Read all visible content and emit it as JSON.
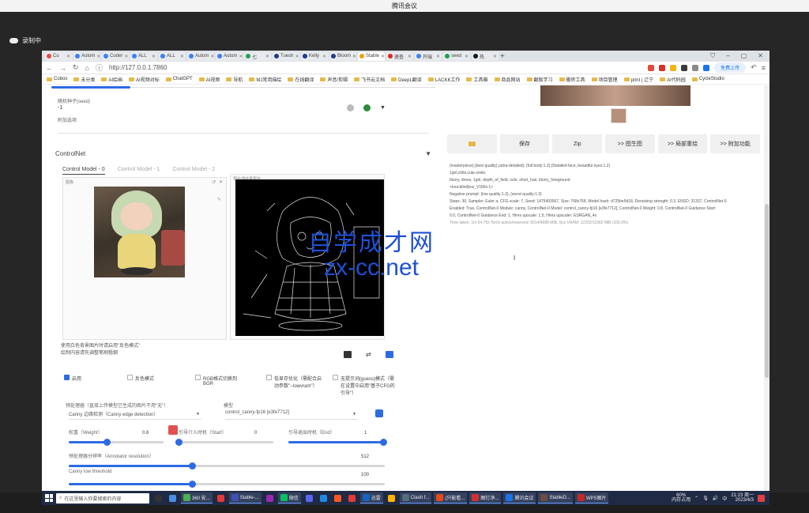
{
  "meeting": {
    "title": "腾讯会议",
    "recording": "录制中"
  },
  "browser": {
    "tabs": [
      {
        "label": "Cu",
        "color": "#e54b3c",
        "active": false
      },
      {
        "label": "Autom",
        "color": "#3b82f6",
        "active": false
      },
      {
        "label": "Coder",
        "color": "#3b82f6",
        "active": false
      },
      {
        "label": "ALL",
        "color": "#3b82f6",
        "active": false
      },
      {
        "label": "ALL",
        "color": "#3b82f6",
        "active": false
      },
      {
        "label": "Autom",
        "color": "#3b82f6",
        "active": false
      },
      {
        "label": "Autom",
        "color": "#3b82f6",
        "active": false
      },
      {
        "label": "七",
        "color": "#22a34a",
        "active": false
      },
      {
        "label": "Tuesh",
        "color": "#1e3a8a",
        "active": false
      },
      {
        "label": "Kelly",
        "color": "#1e3a8a",
        "active": false
      },
      {
        "label": "Bloom",
        "color": "#1e3a8a",
        "active": false
      },
      {
        "label": "Stable",
        "color": "#f59e0b",
        "active": true
      },
      {
        "label": "速查",
        "color": "#dc2626",
        "active": false
      },
      {
        "label": "开端",
        "color": "#3b82f6",
        "active": false
      },
      {
        "label": "seed",
        "color": "#16a34a",
        "active": false
      },
      {
        "label": "热",
        "color": "#111827",
        "active": false
      }
    ],
    "new_tab": "+",
    "url": "http://127.0.0.1:7860",
    "login_label": "免费上传",
    "bookmarks": [
      "Cubox",
      "未分类",
      "AI绘画",
      "AI视频对标",
      "ChatGPT",
      "AI视频",
      "导航",
      "MJ常用描绘",
      "在线翻译",
      "声音/剪辑",
      "飞书云文档",
      "DeepL翻译",
      "LACKK工作",
      "工具箱",
      "商品网站",
      "翻版学习",
      "搬砖工具",
      "项目管理",
      "print | 辽宁",
      "AI代码园",
      "CycleStudio"
    ]
  },
  "left": {
    "seed_label": "随机种子(seed)",
    "seed_value": "-1",
    "seed_extra": "附加选项",
    "controlnet_title": "ControlNet",
    "controlnet_arrow": "▼",
    "tabs": [
      "Control Model - 0",
      "Control Model - 1",
      "Control Model - 2"
    ],
    "image_tag": "图像",
    "preview_tag": "预处理结果预览",
    "hint_line1": "使用白色背景图片时请启用\"反色模式\"",
    "hint_line2": "绘制内容请先调整笔刷粗细",
    "options": {
      "enable": "启用",
      "invert": "反色模式",
      "rgb_bgr": "RGB格式切换到BGR",
      "lowvram": "低显存优化（需配合启动参数\"--lowvram\"）",
      "guess": "无提示词(guess)模式（需在设置中启用\"基于CFG的引导\"）"
    },
    "preprocessor_label": "预处理器（直接上传模型已生成的图片不用\"无\"）",
    "preprocessor_value": "Canny 边缘检测（Canny edge detection）",
    "model_label": "模型",
    "model_value": "control_canny-fp16 [e3fe7712]",
    "weight_label": "权重（Weight）",
    "weight_value": "0.8",
    "weight_level": 0.4,
    "start_label": "引导介入时机（Start）",
    "start_value": "0",
    "start_level": 0.0,
    "end_label": "引导退出时机（End）",
    "end_value": "1",
    "end_level": 1.0,
    "resolution_label": "预处理器分辨率（Annotator resolution）",
    "resolution_value": "512",
    "resolution_level": 0.39,
    "canny_label": "Canny low threshold",
    "canny_value": "100",
    "canny_level": 0.39
  },
  "right": {
    "toolbar": [
      "📁",
      "保存",
      "Zip",
      ">> 图生图",
      ">> 局部重绘",
      ">> 附加功能"
    ],
    "prompt_line1": "(masterpiece),(best quality),(ultra-detailed), (full body:1.2),(Detailed face, beautiful eyes:1.2)",
    "prompt_line2": "1girl,chibi,cute,smile,",
    "prompt_line3": "blurry, dress, 1girl, depth_of_field, solo, short_hair, blurry_foreground",
    "prompt_line4": "<lora:blindbox_V1Mix:1>",
    "negative": "Negative prompt: (low quality:1.3), (worst quality:1.3)",
    "params1": "Steps: 30, Sampler: Euler a, CFG scale: 7, Seed: 1475493967, Size: 768x768, Model hash: d725be5d18, Denoising strength: 0.3, ENSD: 31337, ControlNet-0",
    "params2": "Enabled: True, ControlNet-0 Module: canny, ControlNet-0 Model: control_canny-fp16 [e3fe7712], ControlNet-0 Weight: 0.8, ControlNet-0 Guidance Start:",
    "params3": "0.0, ControlNet-0 Guidance End: 1, Hires upscale: 1.5, Hires upscaler: ESRGAN_4x",
    "time_taken": "Time taken: 1m 54.75s  Torch active/reserved: 8314/9688 MiB, Sys VRAM: 12202/11682 MiB (105.9%)"
  },
  "watermark": {
    "cn": "自学成才网",
    "en": "zx-cc.net"
  },
  "taskbar": {
    "search": "在这里输入你要搜索的内容",
    "apps": [
      "",
      "",
      "360 安...",
      "",
      "Stable-...",
      "",
      "微信",
      "",
      "",
      "",
      "",
      "迅雷",
      "",
      "Clash f...",
      "(只能看...",
      "图钉净...",
      "腾讯会议",
      "StableD...",
      "WPS图片"
    ],
    "memory_line1": "60%",
    "memory_line2": "内存占用",
    "lang": "中",
    "time": "21:23 周一",
    "date": "2023/4/3"
  }
}
